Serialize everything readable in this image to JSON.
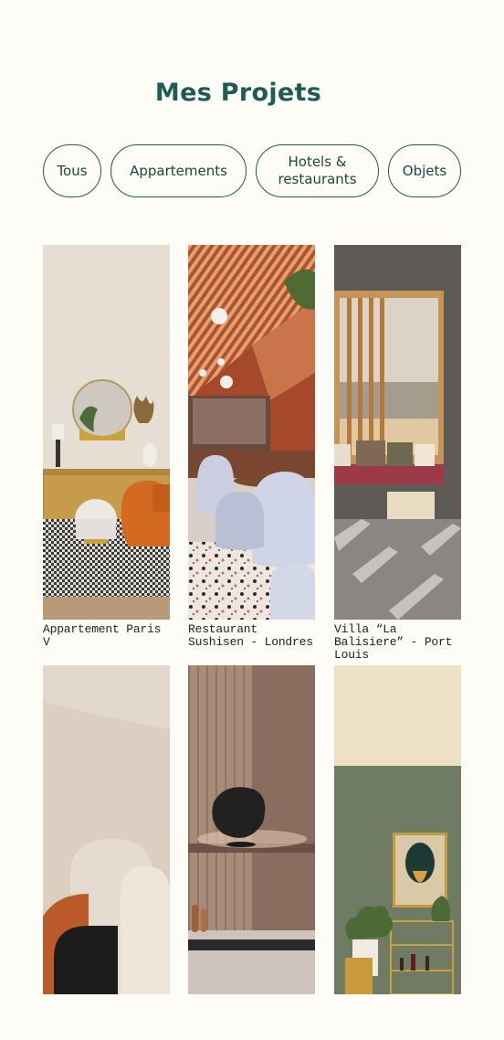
{
  "page": {
    "title": "Mes Projets"
  },
  "filters": [
    {
      "label": "Tous"
    },
    {
      "label": "Appartements"
    },
    {
      "label_line1": "Hotels &",
      "label_line2": "restaurants"
    },
    {
      "label": "Objets"
    }
  ],
  "projects": [
    {
      "caption": "Appartement Paris V",
      "image": "living-room-photo"
    },
    {
      "caption": "Restaurant Sushisen - Londres",
      "image": "restaurant-photo"
    },
    {
      "caption": "Villa “La Balisiere” - Port Louis",
      "image": "villa-photo"
    },
    {
      "caption": "",
      "image": "sculpture-photo"
    },
    {
      "caption": "",
      "image": "lamp-photo"
    },
    {
      "caption": "",
      "image": "bar-cart-photo"
    }
  ],
  "colors": {
    "background": "#fdfcf6",
    "accent": "#1f5b52",
    "text": "#222222"
  }
}
